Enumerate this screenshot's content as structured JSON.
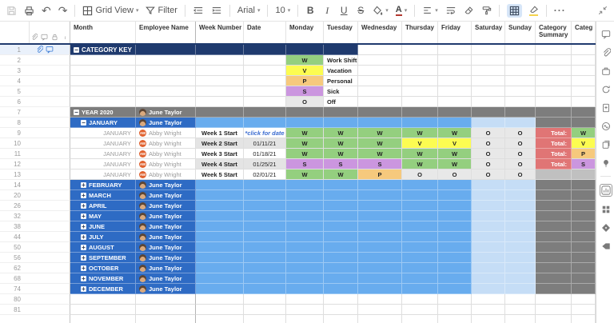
{
  "toolbar": {
    "view_label": "Grid View",
    "filter_label": "Filter",
    "font_name": "Arial",
    "font_size": "10",
    "bold_label": "B",
    "italic_label": "I",
    "underline_label": "U",
    "strike_label": "S",
    "text_color_label": "A",
    "more_label": "···"
  },
  "icons": {
    "undo": "↶",
    "redo": "↷",
    "caret": "▾",
    "minus": "−",
    "plus": "+",
    "info": "i"
  },
  "columns": [
    {
      "id": "month",
      "label": "Month"
    },
    {
      "id": "employee",
      "label": "Employee Name"
    },
    {
      "id": "week",
      "label": "Week Number"
    },
    {
      "id": "date",
      "label": "Date"
    },
    {
      "id": "mon",
      "label": "Monday"
    },
    {
      "id": "tue",
      "label": "Tuesday"
    },
    {
      "id": "wed",
      "label": "Wednesday"
    },
    {
      "id": "thu",
      "label": "Thursday"
    },
    {
      "id": "fri",
      "label": "Friday"
    },
    {
      "id": "sat",
      "label": "Saturday"
    },
    {
      "id": "sun",
      "label": "Sunday"
    },
    {
      "id": "catsum",
      "label": "Category Summary"
    },
    {
      "id": "cat2",
      "label": "Categ"
    }
  ],
  "colors": {
    "navy": "#1F3A6E",
    "month_blue": "#2E6BC4",
    "mid_blue": "#68ACEE",
    "light_blue": "#C5DDF6",
    "dark_gray": "#7D7D7D",
    "summary_gray": "#C0C0C0",
    "alt_gray": "#E4E4E4",
    "total_red": "#E07575",
    "link_blue": "#3A6BD0",
    "W": "#94CF7F",
    "V": "#FCFC51",
    "P": "#F6C97D",
    "S": "#CB96DF",
    "O": "#E8E8E8"
  },
  "legend_title": "CATEGORY KEY",
  "legend": [
    {
      "letter": "W",
      "label": "Work Shift"
    },
    {
      "letter": "V",
      "label": "Vacation"
    },
    {
      "letter": "P",
      "label": "Personal"
    },
    {
      "letter": "S",
      "label": "Sick"
    },
    {
      "letter": "O",
      "label": "Off"
    }
  ],
  "rows": [
    {
      "n": "1",
      "type": "key",
      "label": "CATEGORY KEY",
      "gutter": [
        "attachment",
        "comment"
      ]
    },
    {
      "n": "2",
      "type": "legend",
      "letter": "W",
      "label": "Work Shift"
    },
    {
      "n": "3",
      "type": "legend",
      "letter": "V",
      "label": "Vacation"
    },
    {
      "n": "4",
      "type": "legend",
      "letter": "P",
      "label": "Personal"
    },
    {
      "n": "5",
      "type": "legend",
      "letter": "S",
      "label": "Sick"
    },
    {
      "n": "6",
      "type": "legend",
      "letter": "O",
      "label": "Off"
    },
    {
      "n": "7",
      "type": "year",
      "label": "YEAR 2020",
      "person": "June Taylor"
    },
    {
      "n": "8",
      "type": "month",
      "state": "open",
      "label": "JANUARY",
      "person": "June Taylor"
    },
    {
      "n": "9",
      "type": "week",
      "month": "JANUARY",
      "person": "Abby Wright",
      "initials": "AW",
      "week": "Week 1 Start",
      "date": "*click for date",
      "link": true,
      "alt": false,
      "days": [
        "W",
        "W",
        "W",
        "W",
        "W",
        "O",
        "O"
      ],
      "total": "Total:",
      "cat": "W"
    },
    {
      "n": "10",
      "type": "week",
      "month": "JANUARY",
      "person": "Abby Wright",
      "initials": "AW",
      "week": "Week 2 Start",
      "date": "01/11/21",
      "link": false,
      "alt": true,
      "days": [
        "W",
        "W",
        "W",
        "V",
        "V",
        "O",
        "O"
      ],
      "total": "Total:",
      "cat": "V"
    },
    {
      "n": "11",
      "type": "week",
      "month": "JANUARY",
      "person": "Abby Wright",
      "initials": "AW",
      "week": "Week 3 Start",
      "date": "01/18/21",
      "link": false,
      "alt": false,
      "days": [
        "W",
        "W",
        "W",
        "W",
        "W",
        "O",
        "O"
      ],
      "total": "Total:",
      "cat": "P"
    },
    {
      "n": "12",
      "type": "week",
      "month": "JANUARY",
      "person": "Abby Wright",
      "initials": "AW",
      "week": "Week 4 Start",
      "date": "01/25/21",
      "link": false,
      "alt": true,
      "days": [
        "S",
        "S",
        "S",
        "W",
        "W",
        "O",
        "O"
      ],
      "total": "Total:",
      "cat": "S"
    },
    {
      "n": "13",
      "type": "week",
      "month": "JANUARY",
      "person": "Abby Wright",
      "initials": "AW",
      "week": "Week 5 Start",
      "date": "02/01/21",
      "link": false,
      "alt": false,
      "days": [
        "W",
        "W",
        "P",
        "O",
        "O",
        "O",
        "O"
      ],
      "total": null,
      "cat": null
    },
    {
      "n": "14",
      "type": "month",
      "state": "closed",
      "label": "FEBRUARY",
      "person": "June Taylor"
    },
    {
      "n": "20",
      "type": "month",
      "state": "closed",
      "label": "MARCH",
      "person": "June Taylor"
    },
    {
      "n": "26",
      "type": "month",
      "state": "closed",
      "label": "APRIL",
      "person": "June Taylor"
    },
    {
      "n": "32",
      "type": "month",
      "state": "closed",
      "label": "MAY",
      "person": "June Taylor"
    },
    {
      "n": "38",
      "type": "month",
      "state": "closed",
      "label": "JUNE",
      "person": "June Taylor"
    },
    {
      "n": "44",
      "type": "month",
      "state": "closed",
      "label": "JULY",
      "person": "June Taylor"
    },
    {
      "n": "50",
      "type": "month",
      "state": "closed",
      "label": "AUGUST",
      "person": "June Taylor"
    },
    {
      "n": "56",
      "type": "month",
      "state": "closed",
      "label": "SEPTEMBER",
      "person": "June Taylor"
    },
    {
      "n": "62",
      "type": "month",
      "state": "closed",
      "label": "OCTOBER",
      "person": "June Taylor"
    },
    {
      "n": "68",
      "type": "month",
      "state": "closed",
      "label": "NOVEMBER",
      "person": "June Taylor"
    },
    {
      "n": "74",
      "type": "month",
      "state": "closed",
      "label": "DECEMBER",
      "person": "June Taylor"
    },
    {
      "n": "80",
      "type": "empty"
    },
    {
      "n": "81",
      "type": "empty"
    },
    {
      "n": "",
      "type": "empty",
      "partial": true
    }
  ],
  "rail_icons": [
    "comment",
    "attachment",
    "proofs",
    "update-request",
    "sheet-summary",
    "activity-log",
    "publish",
    "insights",
    "chart",
    "apps",
    "premium",
    "tag"
  ],
  "gutter_header_icons": [
    "attachment",
    "comment",
    "lock",
    "info"
  ]
}
